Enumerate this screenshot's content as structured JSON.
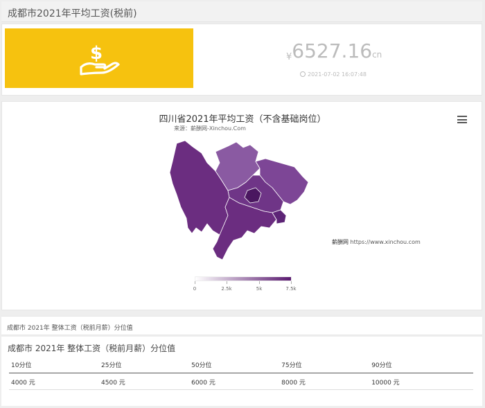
{
  "header": {
    "title": "成都市2021年平均工资(税前)"
  },
  "stat": {
    "icon": "money-hand-icon",
    "currency": "¥",
    "value": "6527.16",
    "unit": "cn",
    "timestamp": "2021-07-02 16:07:48",
    "accent": "#f6c20f"
  },
  "map_chart": {
    "title": "四川省2021年平均工资（不含基础岗位）",
    "subtitle": "来源：薪酬网-Xinchou.Com",
    "watermark_name": "薪酬网",
    "watermark_url": "https://www.xinchou.com",
    "menu_icon": "hamburger-menu-icon",
    "legend_ticks": [
      "0",
      "2.5k",
      "5k",
      "7.5k"
    ],
    "colors": {
      "low": "#ffffff",
      "high": "#5a1a70"
    }
  },
  "section": {
    "label": "成都市 2021年 整体工资（税前月薪）分位值"
  },
  "percentile_table": {
    "title": "成都市 2021年 整体工资（税前月薪）分位值",
    "headers": [
      "10分位",
      "25分位",
      "50分位",
      "75分位",
      "90分位"
    ],
    "values": [
      "4000 元",
      "4500 元",
      "6000 元",
      "8000 元",
      "10000 元"
    ]
  }
}
